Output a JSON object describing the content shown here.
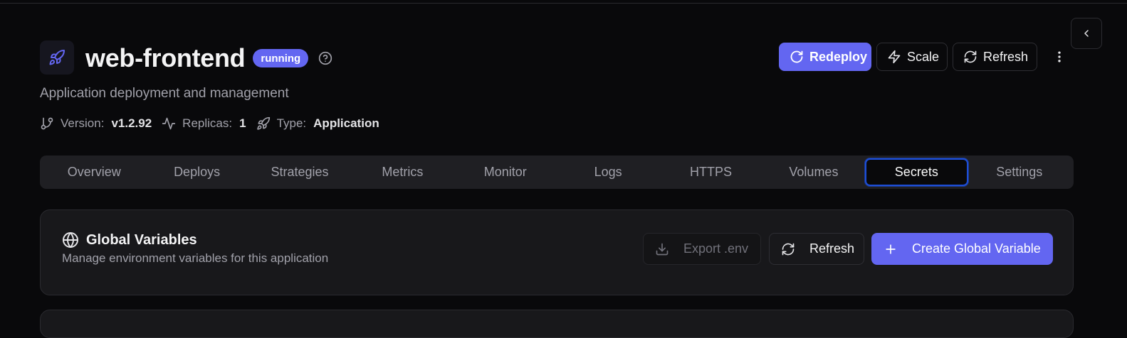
{
  "header": {
    "title": "web-frontend",
    "status": "running",
    "subtitle": "Application deployment and management",
    "meta": {
      "version_label": "Version:",
      "version_value": "v1.2.92",
      "replicas_label": "Replicas:",
      "replicas_value": "1",
      "type_label": "Type:",
      "type_value": "Application"
    }
  },
  "actions": {
    "redeploy": "Redeploy",
    "scale": "Scale",
    "refresh": "Refresh"
  },
  "tabs": [
    {
      "label": "Overview"
    },
    {
      "label": "Deploys"
    },
    {
      "label": "Strategies"
    },
    {
      "label": "Metrics"
    },
    {
      "label": "Monitor"
    },
    {
      "label": "Logs"
    },
    {
      "label": "HTTPS"
    },
    {
      "label": "Volumes"
    },
    {
      "label": "Secrets",
      "active": true
    },
    {
      "label": "Settings"
    }
  ],
  "globals": {
    "title": "Global Variables",
    "description": "Manage environment variables for this application",
    "export_label": "Export .env",
    "refresh_label": "Refresh",
    "create_label": "Create Global Variable"
  },
  "colors": {
    "accent": "#6366f1",
    "background": "#09090b",
    "active_tab_border": "#1d4ed8"
  },
  "icons": {
    "app": "rocket-icon",
    "help": "help-circle-icon",
    "collapse": "chevron-left-icon",
    "more": "more-vertical-icon"
  }
}
